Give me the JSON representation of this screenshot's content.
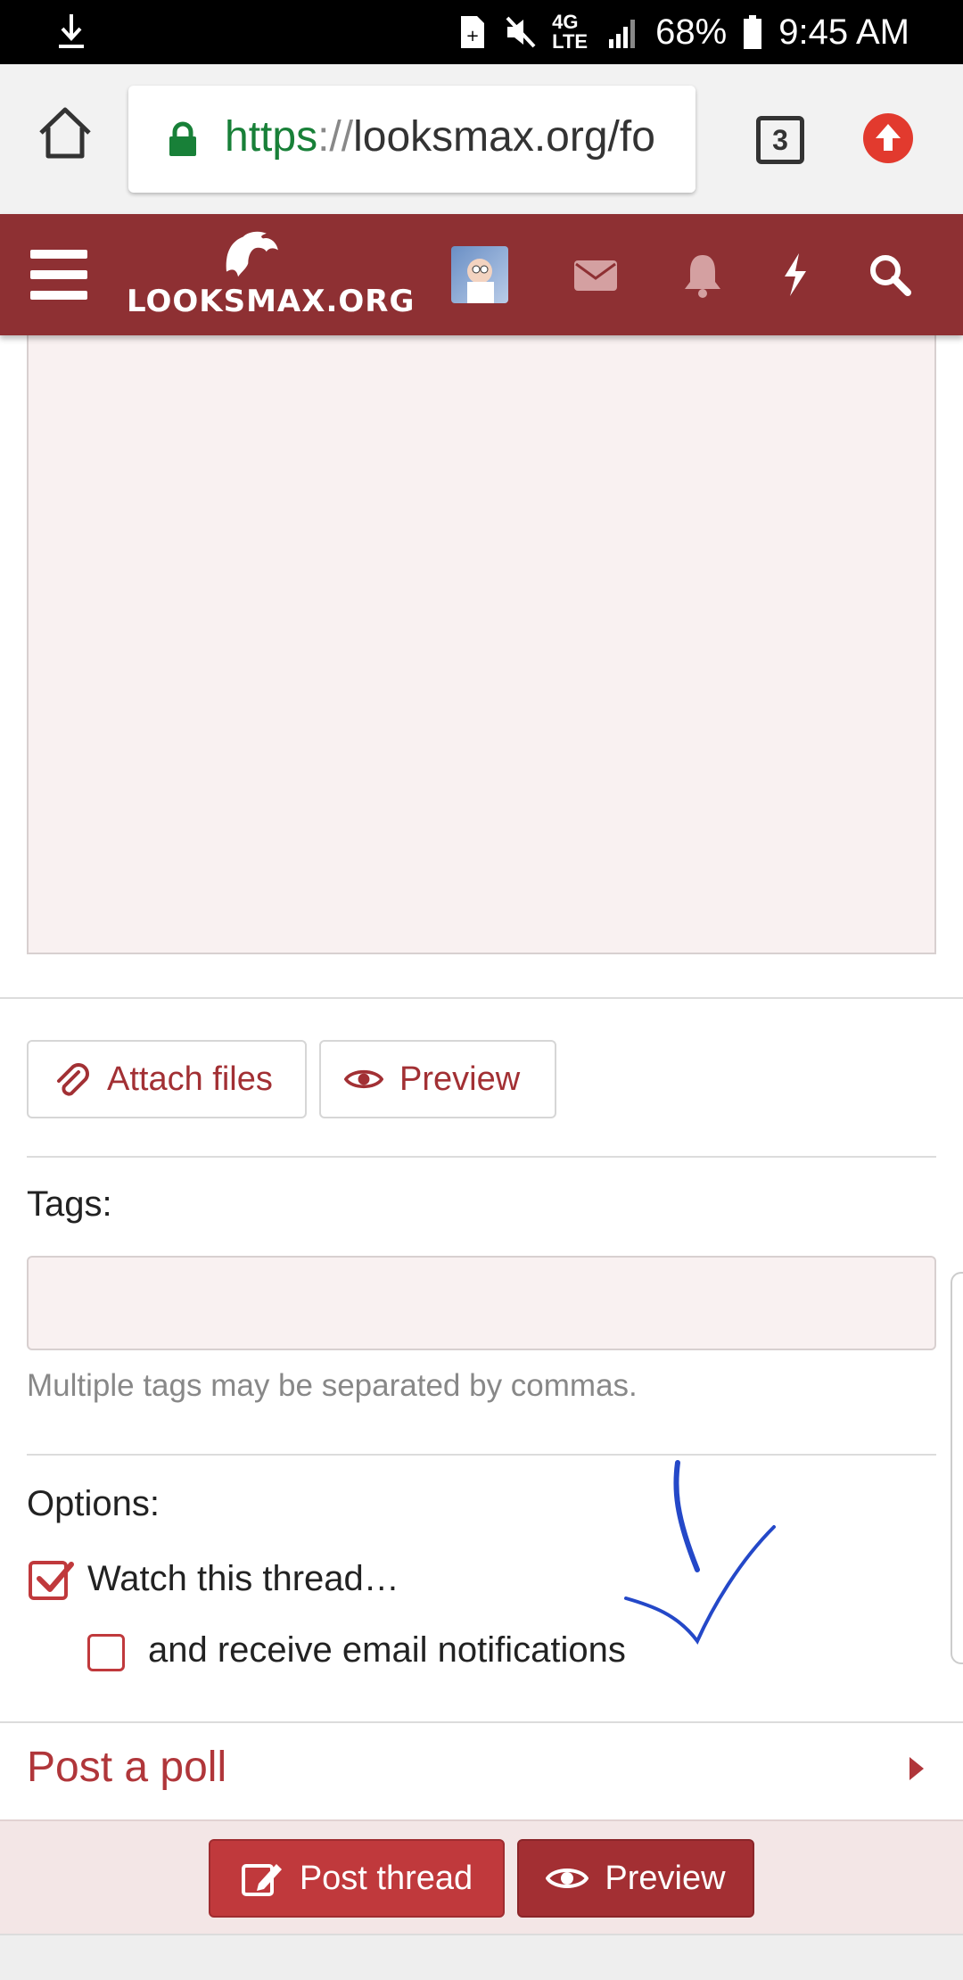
{
  "status_bar": {
    "network": "4G LTE",
    "battery": "68%",
    "time": "9:45 AM",
    "icons": [
      "download-icon",
      "sim-icon",
      "mute-icon",
      "network-icon",
      "signal-icon",
      "battery-icon"
    ]
  },
  "browser": {
    "url_scheme": "https",
    "url_sep": "://",
    "url_rest": "looksmax.org/fo",
    "tab_count": "3",
    "icons": [
      "home-icon",
      "lock-icon",
      "update-icon"
    ]
  },
  "site": {
    "logo_text": "LOOKSMAX.ORG",
    "header_icons": [
      "menu-icon",
      "avatar",
      "envelope-icon",
      "bell-icon",
      "bolt-icon",
      "search-icon"
    ]
  },
  "editor": {
    "attach_label": "Attach files",
    "preview_label": "Preview"
  },
  "tags": {
    "label": "Tags:",
    "value": "",
    "hint": "Multiple tags may be separated by commas."
  },
  "options": {
    "label": "Options:",
    "watch_label": "Watch this thread…",
    "watch_checked": true,
    "email_label": "and receive email notifications",
    "email_checked": false
  },
  "poll": {
    "label": "Post a poll"
  },
  "footer": {
    "post_label": "Post thread",
    "preview_label": "Preview"
  },
  "colors": {
    "brand": "#8e3033",
    "accent": "#c0393c",
    "link": "#b0363a",
    "annotation": "#2448c8"
  }
}
